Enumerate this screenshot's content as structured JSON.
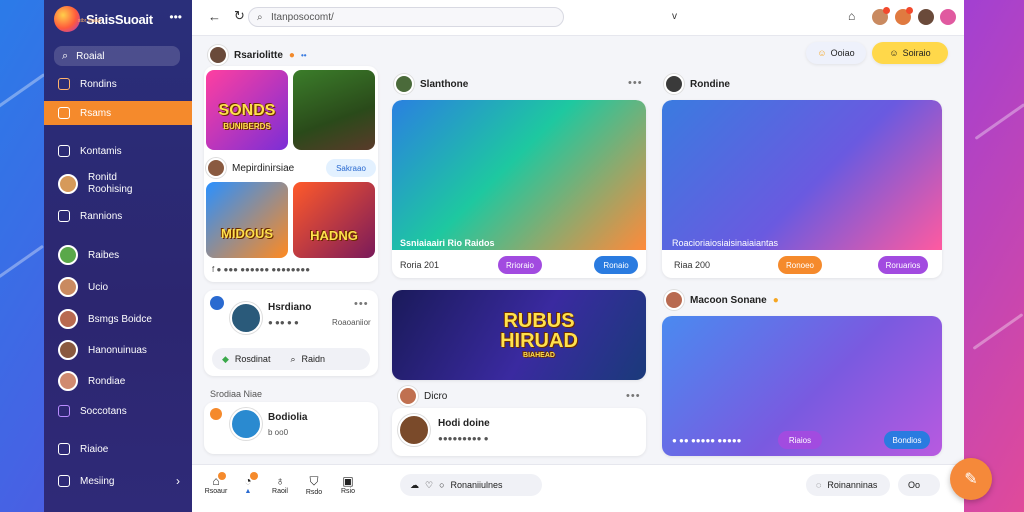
{
  "brand": {
    "name": "SiaisSuoait",
    "tagline": "stbr ssaup",
    "menu_icon": "more-dots-icon"
  },
  "sidebar": {
    "search_label": "Roaial",
    "items": [
      {
        "label": "Rondins",
        "icon": "grid-icon"
      },
      {
        "label": "Rsams",
        "icon": "home-icon",
        "active": true
      },
      {
        "label": "Kontamis",
        "icon": "building-icon"
      },
      {
        "label": "Ronitd\nRoohising",
        "icon": "avatar"
      },
      {
        "label": "Rannions",
        "icon": "square-icon"
      },
      {
        "label": "Raibes",
        "icon": "avatar"
      },
      {
        "label": "Ucio",
        "icon": "avatar"
      },
      {
        "label": "Bsmgs Boidce",
        "icon": "avatar"
      },
      {
        "label": "Hanonuinuas",
        "icon": "avatar"
      },
      {
        "label": "Rondiae",
        "icon": "avatar"
      },
      {
        "label": "Soccotans",
        "icon": "square-icon"
      },
      {
        "label": "Riaioe",
        "icon": "home-icon"
      },
      {
        "label": "Mesiing",
        "icon": "home-icon"
      }
    ],
    "chevron": "›"
  },
  "topbar": {
    "url": "Itanposocomt/",
    "chevron": "v"
  },
  "col1": {
    "header": "Rsariolitte",
    "images": [
      {
        "title": "SONDS",
        "subtitle": "BUNIBERDS"
      },
      {
        "title": ""
      },
      {
        "title": "MIDOUS"
      },
      {
        "title": "HADNG"
      }
    ],
    "section2_title": "Mepirdinirsiae",
    "section2_pill": "Sakraao",
    "meta_row": "f ● ●●● ●●●●●● ●●●●●●●●",
    "post": {
      "name": "Hsrdiano",
      "line": "● ●●  ●  ●",
      "tag": "Roaoaniior"
    },
    "actions": {
      "a": "Rosdinat",
      "b": "Raidn"
    },
    "group_title": "Srodiaa Niae",
    "post2": {
      "name": "Bodiolia",
      "line": "b oo0"
    }
  },
  "col2": {
    "header": "Slanthone",
    "card1": {
      "caption": "Ssniaiaairi Rio Raidos",
      "meta": "Roria 201",
      "btn1": "Rrioraio",
      "btn2": "Ronaio"
    },
    "card2": {
      "title": "RUBUS",
      "title2": "HIRUAD",
      "subtitle": "BIAHEAD"
    },
    "card2_user": "Dicro",
    "post": {
      "name": "Hodi doine",
      "line": "●●●●●●●●● ●"
    }
  },
  "col3": {
    "header": "Rondine",
    "card1": {
      "caption": "Roacioriaiosiaisinaiaiantas",
      "meta": "Riaa 200",
      "btn1": "Ronoeo",
      "btn2": "Roruarios"
    },
    "card2_header": "Macoon Sonane",
    "card2": {
      "caption": "● ●●  ●●●●● ●●●●●",
      "btn1": "Riaios",
      "btn2": "Bondios"
    }
  },
  "header_buttons": {
    "a": "Ooiao",
    "b": "Soiraio"
  },
  "bottom": {
    "tabs": [
      {
        "label": "Rsoaur",
        "icon": "home-icon"
      },
      {
        "label": "",
        "icon": "chat-icon"
      },
      {
        "label": "Raoil",
        "icon": "bell-icon"
      },
      {
        "label": "Rsdo",
        "icon": "shield-icon"
      },
      {
        "label": "Rsio",
        "icon": "box-icon"
      }
    ],
    "chip_center": "Ronaniiulnes",
    "chip_right": "Roinanninas",
    "chip_right2": "Oo"
  }
}
